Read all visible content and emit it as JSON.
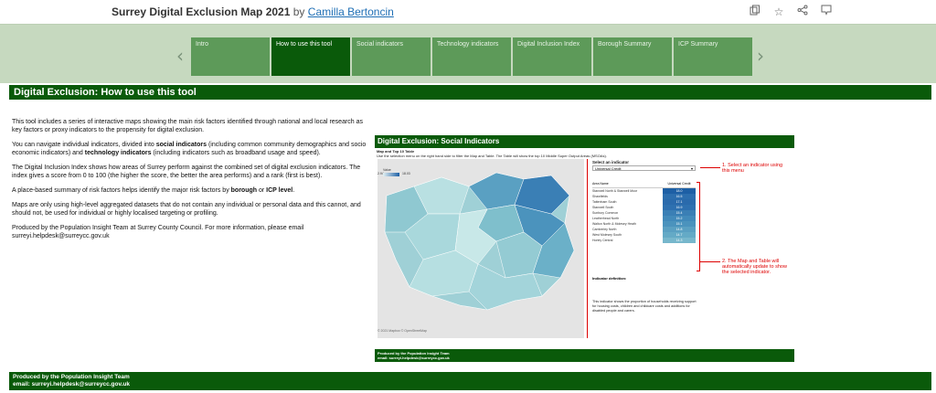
{
  "header": {
    "title": "Surrey Digital Exclusion Map 2021",
    "by": "by",
    "author": "Camilla Bertoncin",
    "icons": [
      "copy-icon",
      "star-icon",
      "share-icon",
      "comment-icon"
    ]
  },
  "nav": {
    "tabs": [
      {
        "label": "Intro",
        "active": false
      },
      {
        "label": "How to use this tool",
        "active": true
      },
      {
        "label": "Social indicators",
        "active": false
      },
      {
        "label": "Technology indicators",
        "active": false
      },
      {
        "label": "Digital Inclusion Index",
        "active": false
      },
      {
        "label": "Borough Summary",
        "active": false
      },
      {
        "label": "ICP Summary",
        "active": false
      }
    ],
    "prev": "‹",
    "next": "›"
  },
  "page": {
    "heading": "Digital Exclusion: How to use this tool",
    "p1": "This tool includes a series of interactive maps showing the main risk factors identified through national and local research as key factors or proxy indicators to the propensity for digital exclusion.",
    "p2a": "You can navigate individual indicators, divided into ",
    "p2b": "social indicators",
    "p2c": " (including common community demographics and socio economic indicators) and ",
    "p2d": "technology indicators",
    "p2e": " (including indicators such as broadband usage and speed).",
    "p3": "The Digital Inclusion Index shows how areas of Surrey perform against the combined set of digital exclusion indicators. The index gives a score from 0 to 100 (the higher the score, the better the area performs) and a rank (first is best).",
    "p4a": "A place-based summary of risk factors helps identify the major risk factors by ",
    "p4b": "borough",
    "p4c": " or ",
    "p4d": "ICP level",
    "p4e": ".",
    "p5": "Maps are only using high-level aggregated datasets that do not contain any individual or personal data and this cannot, and should not, be used for individual or highly localised targeting or profiling.",
    "p6": "Produced by the Population Insight Team at Surrey County Council. For more information, please email surreyi.helpdesk@surreycc.gov.uk"
  },
  "preview": {
    "heading": "Digital Exclusion: Social Indicators",
    "sub1": "Map and Top 10 Table",
    "sub2": "Use the selection menu on the right hand side to filter the Map and Table. The Table will show the top 10 Middle Super Output Areas (MSOAs).",
    "legend_title": "Value",
    "legend_min": "2.94",
    "legend_max": "18.03",
    "map_credit": "© 2021 Mapbox © OpenStreetMap",
    "select_label": "Select an indicator",
    "select_value": "Universal Credit",
    "table_headers": [
      "Area Name",
      "Universal Credit"
    ],
    "rows": [
      {
        "name": "Stanwell North & Stanwell Moor",
        "value": "18.0",
        "color": "#1d5fa5"
      },
      {
        "name": "Shawfields",
        "value": "16.5",
        "color": "#2c6eae"
      },
      {
        "name": "Tattenham South",
        "value": "17.1",
        "color": "#2a6aac"
      },
      {
        "name": "Stanwell South",
        "value": "16.9",
        "color": "#2e70b0"
      },
      {
        "name": "Sunbury Common",
        "value": "15.4",
        "color": "#3a7fb5"
      },
      {
        "name": "Leatherhead North",
        "value": "15.2",
        "color": "#428aba"
      },
      {
        "name": "Walton North & Molesey Heath",
        "value": "15.1",
        "color": "#4b93bd"
      },
      {
        "name": "Camberley North",
        "value": "14.8",
        "color": "#5aa0c2"
      },
      {
        "name": "West Molesey South",
        "value": "14.7",
        "color": "#64aac6"
      },
      {
        "name": "Horley Central",
        "value": "14.3",
        "color": "#77b7cc"
      }
    ],
    "ann1": "1. Select an indicator using this menu",
    "ann2": "2. The Map and Table will automatically update to show the selected indicator.",
    "ind_def": "Indicator definition:",
    "ind_text": "This indicator shows the proportion of households receiving support for housing costs, children and childcare costs and additions for disabled people and carers.",
    "foot1": "Produced by the Population Insight Team",
    "foot2": "email: surreyi.helpdesk@surreycc.gov.uk"
  },
  "footer": {
    "line1": "Produced by the Population Insight Team",
    "line2": "email: surreyi.helpdesk@surreycc.gov.uk"
  }
}
